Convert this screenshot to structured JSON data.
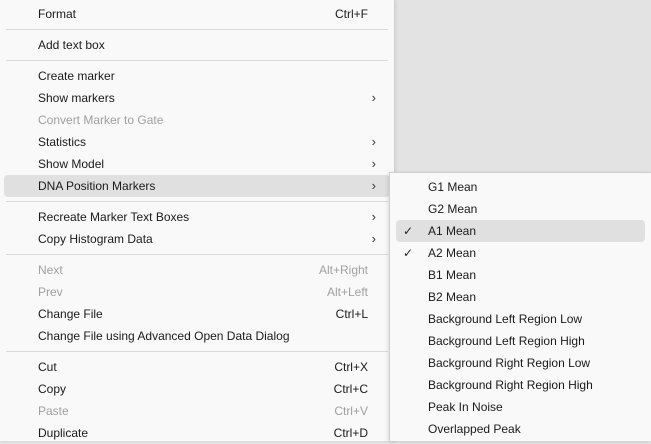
{
  "main_menu": {
    "groups": [
      [
        {
          "label": "Format",
          "shortcut": "Ctrl+F"
        }
      ],
      [
        {
          "label": "Add text box"
        }
      ],
      [
        {
          "label": "Create marker"
        },
        {
          "label": "Show markers",
          "submenu": true
        },
        {
          "label": "Convert Marker to Gate",
          "disabled": true
        },
        {
          "label": "Statistics",
          "submenu": true
        },
        {
          "label": "Show Model",
          "submenu": true
        },
        {
          "label": "DNA Position Markers",
          "submenu": true,
          "highlight": true
        }
      ],
      [
        {
          "label": "Recreate Marker Text Boxes",
          "submenu": true
        },
        {
          "label": "Copy Histogram Data",
          "submenu": true
        }
      ],
      [
        {
          "label": "Next",
          "shortcut": "Alt+Right",
          "disabled": true
        },
        {
          "label": "Prev",
          "shortcut": "Alt+Left",
          "disabled": true
        },
        {
          "label": "Change File",
          "shortcut": "Ctrl+L"
        },
        {
          "label": "Change File using Advanced Open Data Dialog"
        }
      ],
      [
        {
          "label": "Cut",
          "shortcut": "Ctrl+X"
        },
        {
          "label": "Copy",
          "shortcut": "Ctrl+C"
        },
        {
          "label": "Paste",
          "shortcut": "Ctrl+V",
          "disabled": true
        },
        {
          "label": "Duplicate",
          "shortcut": "Ctrl+D"
        }
      ]
    ]
  },
  "dna_submenu": {
    "items": [
      {
        "label": "G1 Mean"
      },
      {
        "label": "G2 Mean"
      },
      {
        "label": "A1 Mean",
        "checked": true,
        "highlight": true
      },
      {
        "label": "A2 Mean",
        "checked": true
      },
      {
        "label": "B1 Mean"
      },
      {
        "label": "B2 Mean"
      },
      {
        "label": "Background Left Region Low"
      },
      {
        "label": "Background Left Region High"
      },
      {
        "label": "Background Right Region Low"
      },
      {
        "label": "Background Right Region High"
      },
      {
        "label": "Peak In Noise"
      },
      {
        "label": "Overlapped Peak"
      }
    ]
  },
  "glyphs": {
    "submenu_arrow": "›",
    "checkmark": "✓"
  }
}
